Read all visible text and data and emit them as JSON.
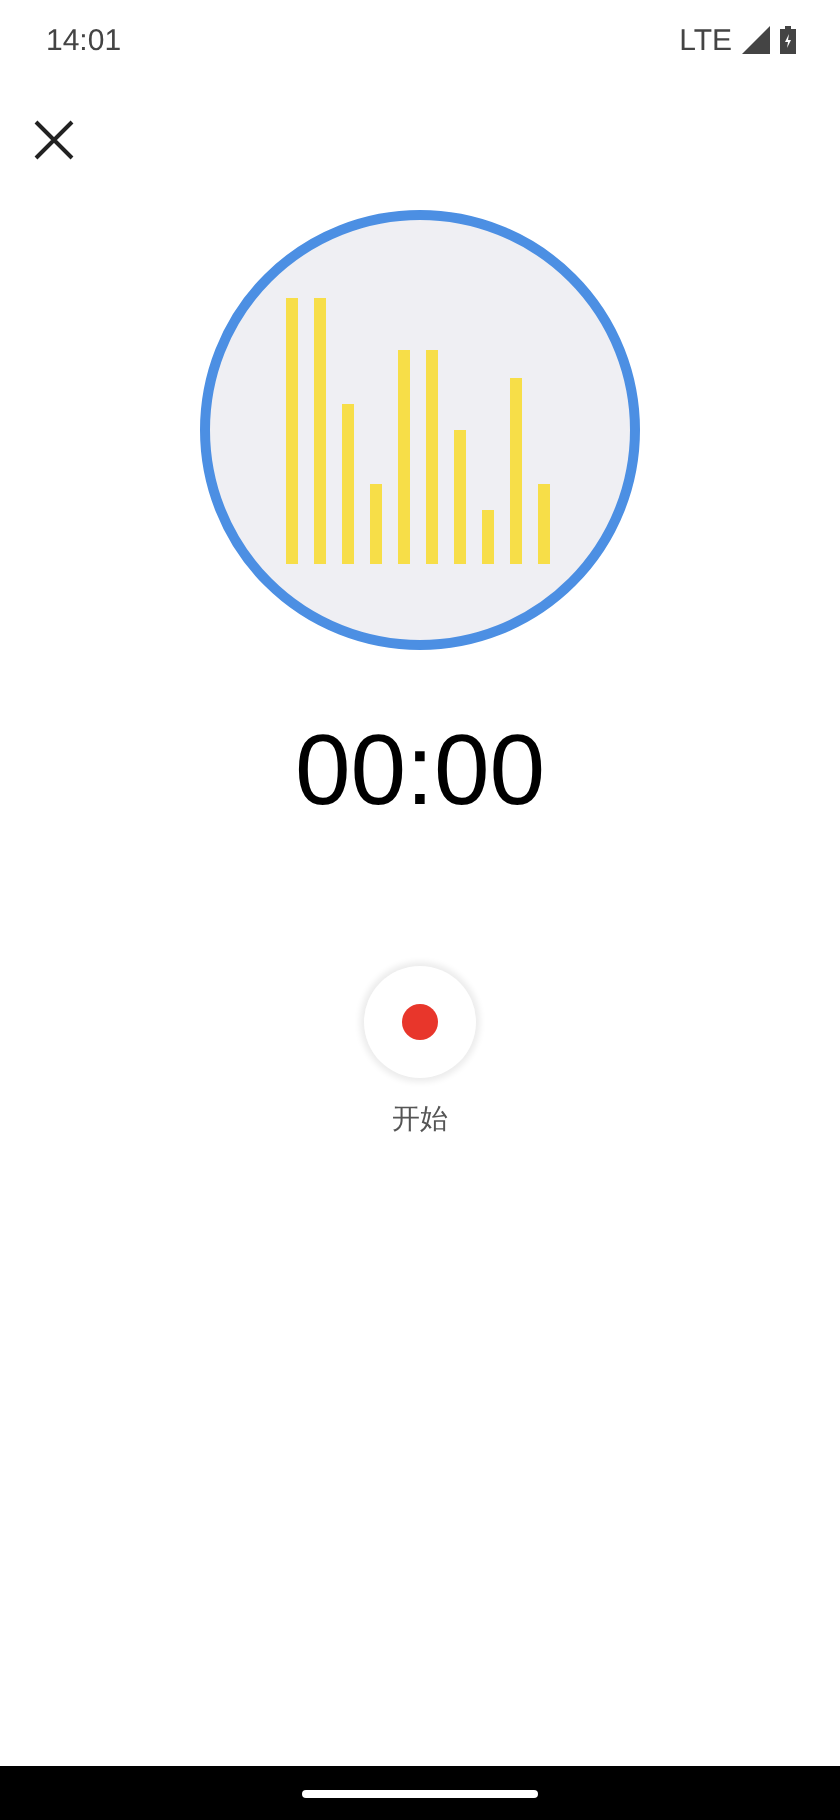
{
  "status_bar": {
    "time": "14:01",
    "network": "LTE"
  },
  "timer": "00:00",
  "record": {
    "label": "开始"
  }
}
